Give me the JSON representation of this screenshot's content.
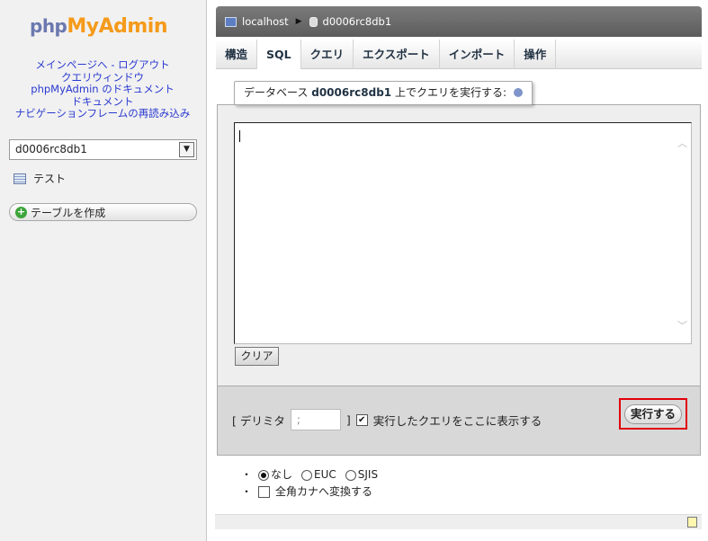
{
  "nav": {
    "logo_php": "php",
    "logo_myadmin": "MyAdmin",
    "links_row1a": "メインページへ",
    "links_row1b": "- ログアウト",
    "links_row2": "クエリウィンドウ",
    "links_row3": "phpMyAdmin のドキュメント",
    "links_row4": "ドキュメント",
    "links_row5": "ナビゲーションフレームの再読み込み",
    "db_selected": "d0006rc8db1",
    "table_item": "テスト",
    "create_table": "テーブルを作成"
  },
  "breadcrumb": {
    "server": "localhost",
    "database": "d0006rc8db1"
  },
  "tabs": [
    "構造",
    "SQL",
    "クエリ",
    "エクスポート",
    "インポート",
    "操作"
  ],
  "active_tab": "SQL",
  "query": {
    "legend_prefix": "データベース",
    "legend_db": "d0006rc8db1",
    "legend_suffix": "上でクエリを実行する:",
    "textarea_value": "",
    "clear_button": "クリア"
  },
  "footer": {
    "delimiter_label_open": "[ デリミタ",
    "delimiter_value": ";",
    "delimiter_label_close": "]",
    "show_query_label": "実行したクエリをここに表示する",
    "show_query_checked": true,
    "go_button": "実行する"
  },
  "options": {
    "bullet": "・",
    "charset_options": [
      "なし",
      "EUC",
      "SJIS"
    ],
    "charset_selected": "なし",
    "kana_label": "全角カナへ変換する",
    "kana_checked": false
  },
  "colors": {
    "highlight_border": "#e0000b",
    "logo_php": "#6c78af",
    "logo_myadmin": "#f59a1a",
    "link": "#2a3ad0"
  }
}
